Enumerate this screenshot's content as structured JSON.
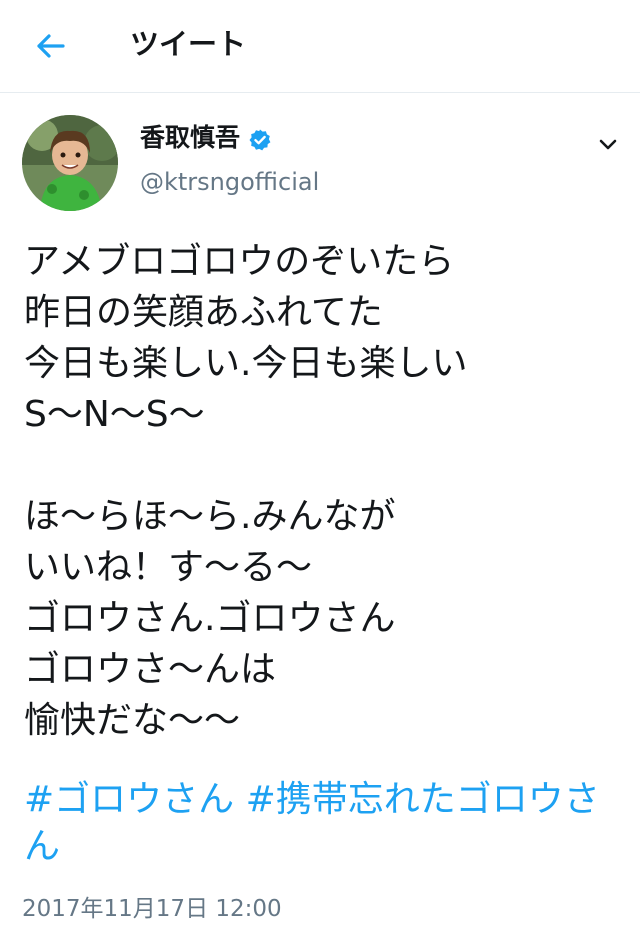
{
  "header": {
    "title": "ツイート",
    "back_icon": "arrow-left-icon"
  },
  "tweet": {
    "author": {
      "name": "香取慎吾",
      "handle": "@ktrsngofficial",
      "verified": true
    },
    "lines": [
      "アメブロゴロウのぞいたら",
      "昨日の笑顔あふれてた",
      "今日も楽しい.今日も楽しい",
      "S〜N〜S〜",
      "",
      "ほ〜らほ〜ら.みんなが",
      "いいね！す〜る〜",
      "ゴロウさん.ゴロウさん",
      "ゴロウさ〜んは",
      "愉快だな〜〜"
    ],
    "hashtags": [
      "#ゴロウさん",
      "#携帯忘れたゴロウさん"
    ],
    "timestamp": "2017年11月17日 12:00"
  },
  "colors": {
    "accent": "#1da1f2",
    "text": "#14171a",
    "secondary": "#657786"
  }
}
